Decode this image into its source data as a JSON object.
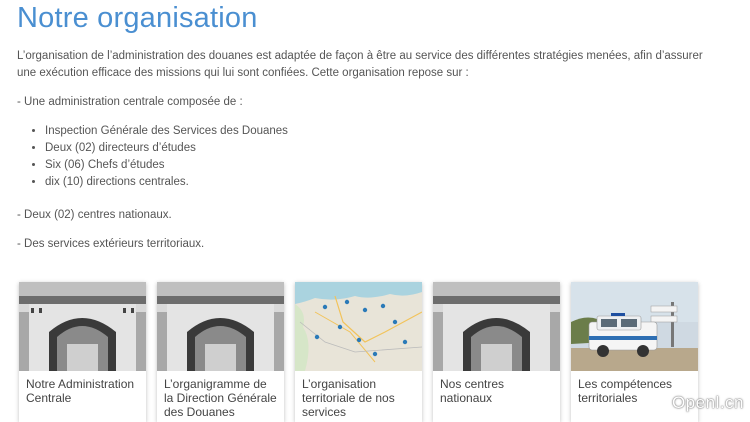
{
  "page": {
    "title": "Notre organisation",
    "intro": "L’organisation de l’administration des douanes est adaptée de façon à être au service des différentes stratégies menées, afin d’assurer une exécution efficace des missions qui lui sont confiées. Cette organisation repose sur :",
    "central_heading": "- Une administration centrale composée de :",
    "central_items": [
      "Inspection Générale des Services des Douanes",
      "Deux (02) directeurs d’études",
      "Six (06) Chefs d’études",
      "dix (10) directions centrales."
    ],
    "national_centers": "- Deux (02) centres nationaux.",
    "external_services": "- Des services extérieurs territoriaux."
  },
  "cards": [
    {
      "caption": "Notre Administration Centrale",
      "image": "building-gate"
    },
    {
      "caption": "L’organigramme de la Direction Générale des Douanes",
      "image": "building-gate"
    },
    {
      "caption": "L’organisation territoriale de nos services",
      "image": "map"
    },
    {
      "caption": "Nos centres nationaux",
      "image": "building-gate"
    },
    {
      "caption": "Les compétences territoriales",
      "image": "customs-vehicle"
    }
  ],
  "watermark": "Openl.cn",
  "colors": {
    "title": "#4a8fd1",
    "text": "#555555"
  }
}
